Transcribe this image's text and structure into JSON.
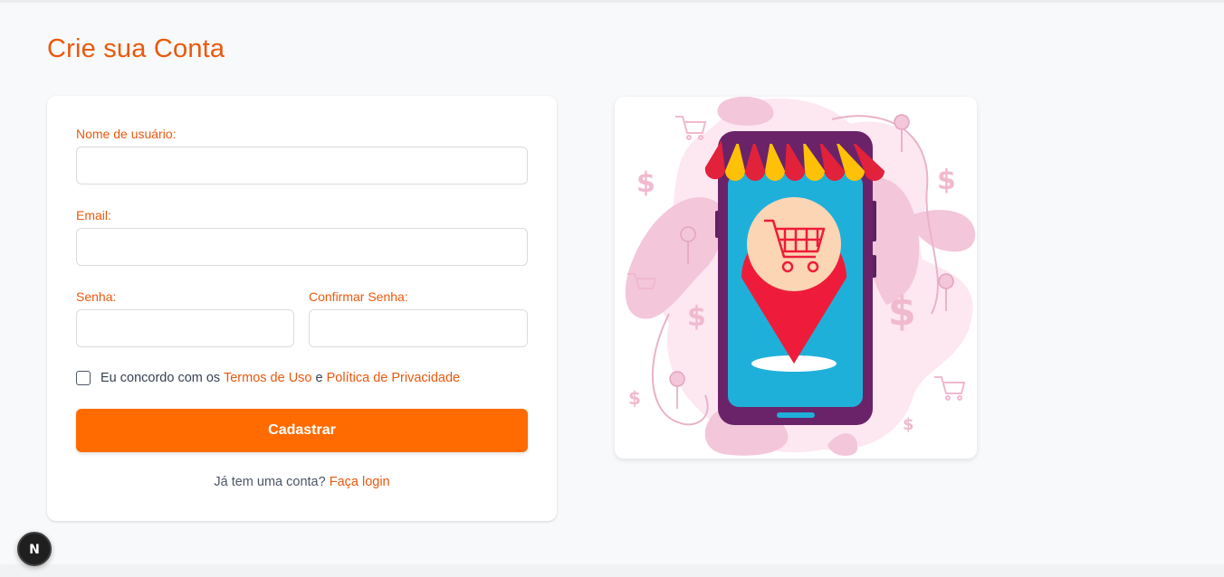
{
  "page": {
    "title": "Crie sua Conta"
  },
  "form": {
    "username_label": "Nome de usuário:",
    "username_value": "",
    "email_label": "Email:",
    "email_value": "",
    "password_label": "Senha:",
    "password_value": "",
    "confirm_password_label": "Confirmar Senha:",
    "confirm_password_value": "",
    "terms": {
      "checked": false,
      "prefix": "Eu concordo com os",
      "terms_link": "Termos de Uso",
      "conjunction": "e",
      "privacy_link": "Política de Privacidade"
    },
    "submit_label": "Cadastrar",
    "login_prompt": "Já tem uma conta?",
    "login_link": "Faça login"
  },
  "illustration": {
    "icons": [
      "storefront-phone-icon",
      "shopping-cart-icon",
      "location-pin-icon",
      "dollar-icon"
    ]
  },
  "badge": {
    "label": "N"
  },
  "colors": {
    "accent": "#ea580c",
    "button": "#ff6b00",
    "background": "#f8f9fb"
  }
}
